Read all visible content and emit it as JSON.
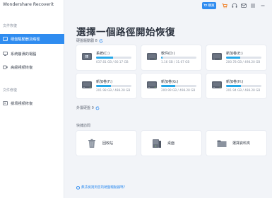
{
  "app": {
    "title": "Wondershare Recoverit"
  },
  "sidebar": {
    "section1": "文件恢復",
    "items": [
      {
        "label": "硬盤驅動器及路徑",
        "icon": "hard-drive-icon"
      },
      {
        "label": "系統崩潰的電腦",
        "icon": "monitor-icon"
      },
      {
        "label": "高級視頻恢復",
        "icon": "video-icon"
      }
    ],
    "section2": "文件修復",
    "repair_items": [
      {
        "label": "損壞視頻修復",
        "icon": "video-repair-icon"
      }
    ]
  },
  "topbar": {
    "buy_label": "購買"
  },
  "main": {
    "title": "選擇一個路徑開始恢復",
    "drives_label": "硬盤驅動器 8",
    "external_label": "外置硬盤 0",
    "quick_label": "快捷訪問",
    "help_link": "無法檢測到您的硬盤驅動器嗎？"
  },
  "drives": [
    {
      "name": "系統(C:)",
      "size": "037.81 GB / 80.17 GB",
      "fill": 0.47
    },
    {
      "name": "軟件(D:)",
      "size": "1.16 GB / 31.67 GB",
      "fill": 0.04
    },
    {
      "name": "新加卷(E:)",
      "size": "200.78 GB / 498.20 GB",
      "fill": 0.4
    },
    {
      "name": "新加卷(F:)",
      "size": "201.98 GB / 488.28 GB",
      "fill": 0.41
    },
    {
      "name": "新加卷(G:)",
      "size": "200.99 GB / 498.28 GB",
      "fill": 0.4
    },
    {
      "name": "新加卷(H:)",
      "size": "201.94 GB / 488.28 GB",
      "fill": 0.41
    }
  ],
  "quick_access": [
    {
      "label": "回收站",
      "icon": "recycle-bin-icon"
    },
    {
      "label": "桌面",
      "icon": "desktop-icon"
    },
    {
      "label": "選擇資料夾",
      "icon": "folder-icon"
    }
  ],
  "colors": {
    "accent": "#2f8cf0",
    "bar": "#26a8e8"
  }
}
